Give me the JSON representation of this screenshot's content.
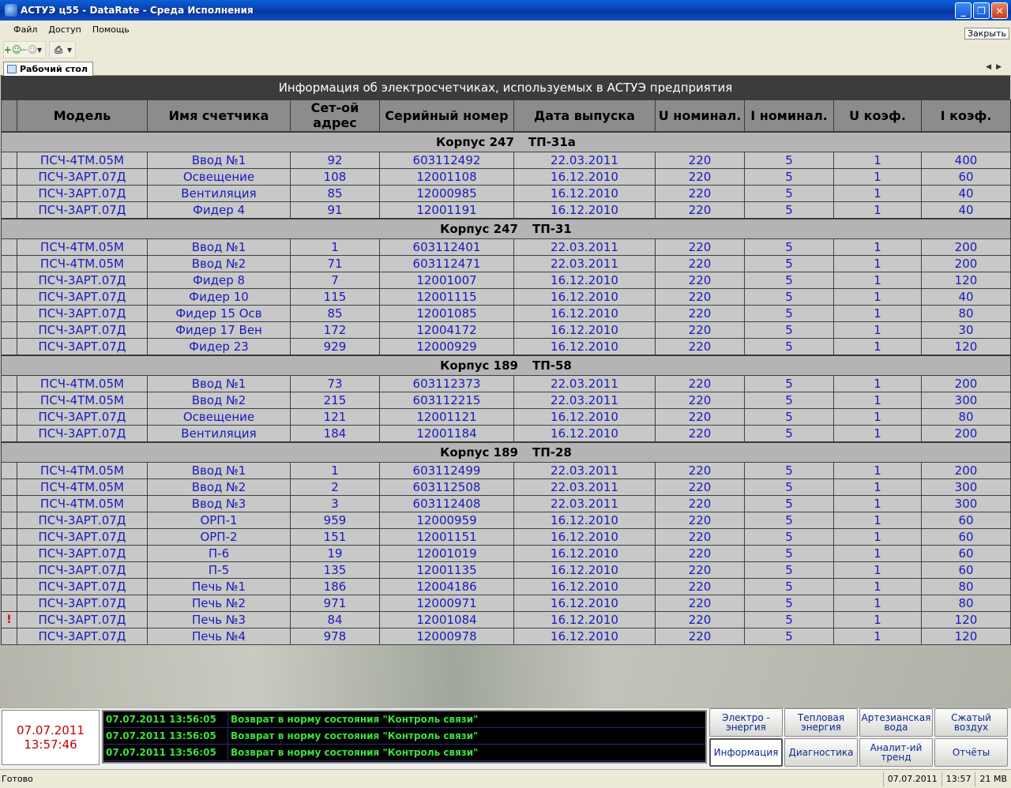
{
  "window": {
    "title": "АСТУЭ ц55 - DataRate - Среда Исполнения",
    "controls": [
      "_",
      "❐",
      "✕"
    ]
  },
  "menu": {
    "items": [
      "Файл",
      "Доступ",
      "Помощь"
    ],
    "close_label": "Закрыть"
  },
  "tabs": {
    "active_label": "Рабочий стол"
  },
  "table": {
    "title": "Информация об электросчетчиках, используемых в АСТУЭ предприятия",
    "columns": [
      "",
      "Модель",
      "Имя счетчика",
      "Сет-ой адрес",
      "Серийный номер",
      "Дата выпуска",
      "U номинал.",
      "I номинал.",
      "U коэф.",
      "I коэф."
    ],
    "groups": [
      {
        "building": "Корпус 247",
        "substation": "ТП-31а",
        "rows": [
          [
            "",
            "ПСЧ-4ТМ.05М",
            "Ввод №1",
            "92",
            "603112492",
            "22.03.2011",
            "220",
            "5",
            "1",
            "400"
          ],
          [
            "",
            "ПСЧ-3АРТ.07Д",
            "Освещение",
            "108",
            "12001108",
            "16.12.2010",
            "220",
            "5",
            "1",
            "60"
          ],
          [
            "",
            "ПСЧ-3АРТ.07Д",
            "Вентиляция",
            "85",
            "12000985",
            "16.12.2010",
            "220",
            "5",
            "1",
            "40"
          ],
          [
            "",
            "ПСЧ-3АРТ.07Д",
            "Фидер 4",
            "91",
            "12001191",
            "16.12.2010",
            "220",
            "5",
            "1",
            "40"
          ]
        ]
      },
      {
        "building": "Корпус 247",
        "substation": "ТП-31",
        "rows": [
          [
            "",
            "ПСЧ-4ТМ.05М",
            "Ввод №1",
            "1",
            "603112401",
            "22.03.2011",
            "220",
            "5",
            "1",
            "200"
          ],
          [
            "",
            "ПСЧ-4ТМ.05М",
            "Ввод №2",
            "71",
            "603112471",
            "22.03.2011",
            "220",
            "5",
            "1",
            "200"
          ],
          [
            "",
            "ПСЧ-3АРТ.07Д",
            "Фидер 8",
            "7",
            "12001007",
            "16.12.2010",
            "220",
            "5",
            "1",
            "120"
          ],
          [
            "",
            "ПСЧ-3АРТ.07Д",
            "Фидер 10",
            "115",
            "12001115",
            "16.12.2010",
            "220",
            "5",
            "1",
            "40"
          ],
          [
            "",
            "ПСЧ-3АРТ.07Д",
            "Фидер 15 Осв",
            "85",
            "12001085",
            "16.12.2010",
            "220",
            "5",
            "1",
            "80"
          ],
          [
            "",
            "ПСЧ-3АРТ.07Д",
            "Фидер 17 Вен",
            "172",
            "12004172",
            "16.12.2010",
            "220",
            "5",
            "1",
            "30"
          ],
          [
            "",
            "ПСЧ-3АРТ.07Д",
            "Фидер 23",
            "929",
            "12000929",
            "16.12.2010",
            "220",
            "5",
            "1",
            "120"
          ]
        ]
      },
      {
        "building": "Корпус 189",
        "substation": "ТП-58",
        "rows": [
          [
            "",
            "ПСЧ-4ТМ.05М",
            "Ввод №1",
            "73",
            "603112373",
            "22.03.2011",
            "220",
            "5",
            "1",
            "200"
          ],
          [
            "",
            "ПСЧ-4ТМ.05М",
            "Ввод №2",
            "215",
            "603112215",
            "22.03.2011",
            "220",
            "5",
            "1",
            "300"
          ],
          [
            "",
            "ПСЧ-3АРТ.07Д",
            "Освещение",
            "121",
            "12001121",
            "16.12.2010",
            "220",
            "5",
            "1",
            "80"
          ],
          [
            "",
            "ПСЧ-3АРТ.07Д",
            "Вентиляция",
            "184",
            "12001184",
            "16.12.2010",
            "220",
            "5",
            "1",
            "200"
          ]
        ]
      },
      {
        "building": "Корпус 189",
        "substation": "ТП-28",
        "rows": [
          [
            "",
            "ПСЧ-4ТМ.05М",
            "Ввод №1",
            "1",
            "603112499",
            "22.03.2011",
            "220",
            "5",
            "1",
            "200"
          ],
          [
            "",
            "ПСЧ-4ТМ.05М",
            "Ввод №2",
            "2",
            "603112508",
            "22.03.2011",
            "220",
            "5",
            "1",
            "300"
          ],
          [
            "",
            "ПСЧ-4ТМ.05М",
            "Ввод №3",
            "3",
            "603112408",
            "22.03.2011",
            "220",
            "5",
            "1",
            "300"
          ],
          [
            "",
            "ПСЧ-3АРТ.07Д",
            "ОРП-1",
            "959",
            "12000959",
            "16.12.2010",
            "220",
            "5",
            "1",
            "60"
          ],
          [
            "",
            "ПСЧ-3АРТ.07Д",
            "ОРП-2",
            "151",
            "12001151",
            "16.12.2010",
            "220",
            "5",
            "1",
            "60"
          ],
          [
            "",
            "ПСЧ-3АРТ.07Д",
            "П-6",
            "19",
            "12001019",
            "16.12.2010",
            "220",
            "5",
            "1",
            "60"
          ],
          [
            "",
            "ПСЧ-3АРТ.07Д",
            "П-5",
            "135",
            "12001135",
            "16.12.2010",
            "220",
            "5",
            "1",
            "60"
          ],
          [
            "",
            "ПСЧ-3АРТ.07Д",
            "Печь №1",
            "186",
            "12004186",
            "16.12.2010",
            "220",
            "5",
            "1",
            "80"
          ],
          [
            "",
            "ПСЧ-3АРТ.07Д",
            "Печь №2",
            "971",
            "12000971",
            "16.12.2010",
            "220",
            "5",
            "1",
            "80"
          ],
          [
            "!",
            "ПСЧ-3АРТ.07Д",
            "Печь №3",
            "84",
            "12001084",
            "16.12.2010",
            "220",
            "5",
            "1",
            "120"
          ],
          [
            "",
            "ПСЧ-3АРТ.07Д",
            "Печь №4",
            "978",
            "12000978",
            "16.12.2010",
            "220",
            "5",
            "1",
            "120"
          ]
        ]
      }
    ]
  },
  "clock": {
    "date": "07.07.2011",
    "time": "13:57:46"
  },
  "events": [
    {
      "time": "07.07.2011 13:56:05",
      "text": "Возврат в норму состояния \"Контроль связи\""
    },
    {
      "time": "07.07.2011 13:56:05",
      "text": "Возврат в норму состояния \"Контроль связи\""
    },
    {
      "time": "07.07.2011 13:56:05",
      "text": "Возврат в норму состояния \"Контроль связи\""
    }
  ],
  "nav": {
    "buttons": [
      {
        "id": "elektro",
        "label": "Электро - энергия"
      },
      {
        "id": "teplo",
        "label": "Тепловая энергия"
      },
      {
        "id": "voda",
        "label": "Артезианская вода"
      },
      {
        "id": "vozduh",
        "label": "Сжатый воздух"
      },
      {
        "id": "info",
        "label": "Информация",
        "active": true
      },
      {
        "id": "diag",
        "label": "Диагностика"
      },
      {
        "id": "trend",
        "label": "Аналит-ий тренд"
      },
      {
        "id": "reports",
        "label": "Отчёты"
      }
    ]
  },
  "status": {
    "left": "Готово",
    "date": "07.07.2011",
    "time": "13:57",
    "memory": "21 MB"
  }
}
